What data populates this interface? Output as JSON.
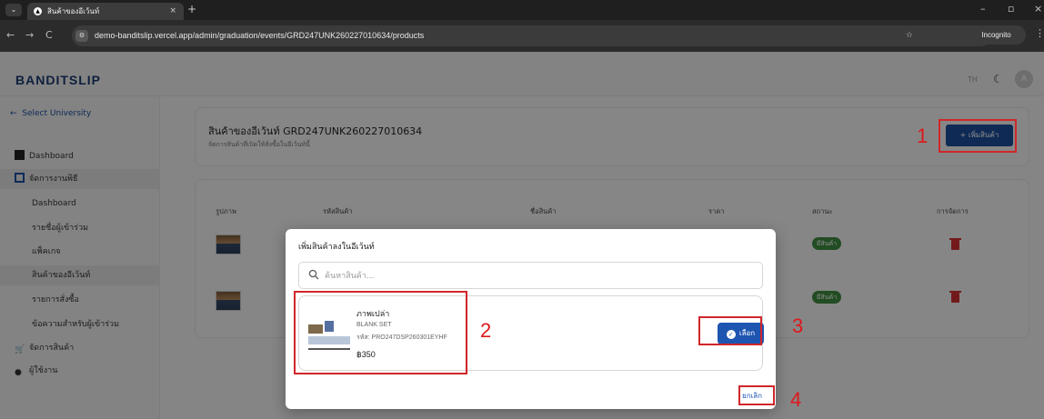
{
  "browser": {
    "tab_title": "สินค้าของอีเว้นท์",
    "url": "demo-banditslip.vercel.app/admin/graduation/events/GRD247UNK260227010634/products",
    "incognito_label": "Incognito"
  },
  "header": {
    "brand": "BANDITSLIP",
    "lang": "TH",
    "avatar_letter": "A"
  },
  "sidebar": {
    "back_label": "Select University",
    "items": [
      {
        "label": "Dashboard"
      },
      {
        "label": "จัดการงานพิธี"
      },
      {
        "label": "Dashboard"
      },
      {
        "label": "รายชื่อผู้เข้าร่วม"
      },
      {
        "label": "แพ็คเกจ"
      },
      {
        "label": "สินค้าของอีเว้นท์"
      },
      {
        "label": "รายการสั่งซื้อ"
      },
      {
        "label": "ข้อความสำหรับผู้เข้าร่วม"
      },
      {
        "label": "จัดการสินค้า"
      },
      {
        "label": "ผู้ใช้งาน"
      }
    ]
  },
  "page": {
    "title": "สินค้าของอีเว้นท์ GRD247UNK260227010634",
    "subtitle": "จัดการสินค้าที่เปิดให้สั่งซื้อในอีเว้นท์นี้",
    "add_button": "+ เพิ่มสินค้า"
  },
  "table": {
    "columns": [
      "รูปภาพ",
      "รหัสสินค้า",
      "ชื่อสินค้า",
      "ราคา",
      "สถานะ",
      "การจัดการ"
    ],
    "rows": [
      {
        "status": "มีสินค้า"
      },
      {
        "status": "มีสินค้า"
      }
    ]
  },
  "modal": {
    "title": "เพิ่มสินค้าลงในอีเว้นท์",
    "search_placeholder": "ค้นหาสินค้า...",
    "product": {
      "name": "ภาพเปล่า",
      "set": "BLANK SET",
      "code": "รหัส: PRO247DSP260301EYHF",
      "price": "฿350"
    },
    "select_button": "เลือก",
    "cancel_button": "ยกเลิก"
  },
  "annotations": [
    "1",
    "2",
    "3",
    "4"
  ],
  "colors": {
    "accent": "#1d4e9a",
    "highlight": "#d0262a",
    "badge": "#3f8a3f",
    "delete": "#d03030"
  }
}
